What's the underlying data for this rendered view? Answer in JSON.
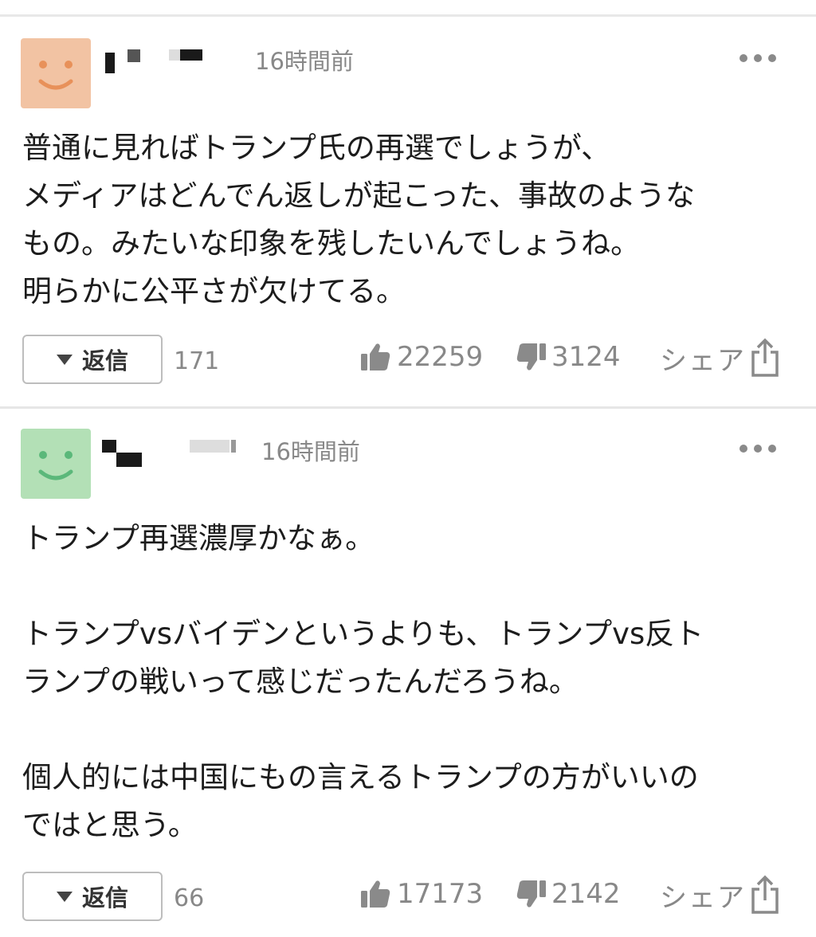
{
  "comments": [
    {
      "avatar_color": "#f2c3a3",
      "avatar_face_color": "#e8915a",
      "timestamp": "16時間前",
      "body": "普通に見ればトランプ氏の再選でしょうが、\nメディアはどんでん返しが起こった、事故のような\nもの。みたいな印象を残したいんでしょうね。\n明らかに公平さが欠けてる。",
      "reply_label": "返信",
      "reply_count": "171",
      "likes": "22259",
      "dislikes": "3124",
      "share_label": "シェア"
    },
    {
      "avatar_color": "#b3e0b6",
      "avatar_face_color": "#5bb87a",
      "timestamp": "16時間前",
      "body": "トランプ再選濃厚かなぁ。\n\nトランプvsバイデンというよりも、トランプvs反ト\nランプの戦いって感じだったんだろうね。\n\n個人的には中国にもの言えるトランプの方がいいの\nではと思う。",
      "reply_label": "返信",
      "reply_count": "66",
      "likes": "17173",
      "dislikes": "2142",
      "share_label": "シェア"
    }
  ],
  "icons": {
    "more": "more-dots-icon",
    "like": "thumbs-up-icon",
    "dislike": "thumbs-down-icon",
    "share": "share-icon",
    "reply": "triangle-down-icon"
  }
}
